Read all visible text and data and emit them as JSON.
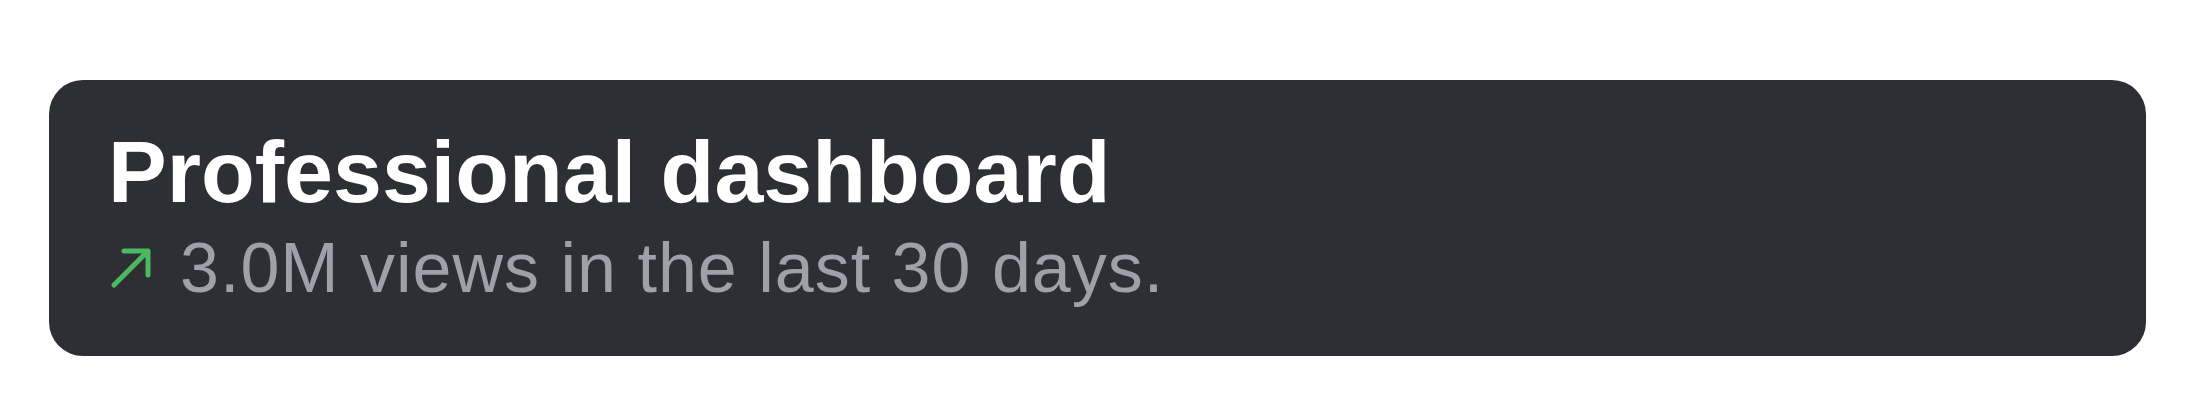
{
  "card": {
    "title": "Professional dashboard",
    "trending_up": true,
    "summary": "3.0M views in the last 30 days."
  }
}
